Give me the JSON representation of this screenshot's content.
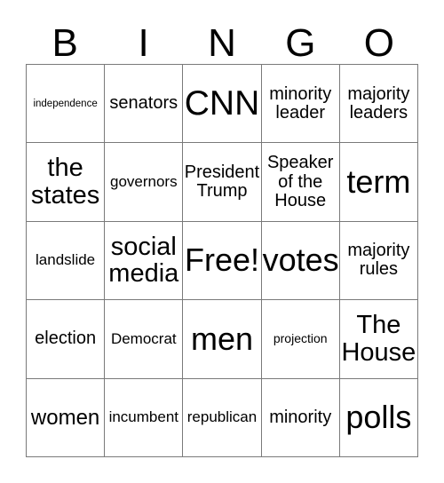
{
  "card": {
    "type": "bingo-card",
    "header_letters": [
      "B",
      "I",
      "N",
      "G",
      "O"
    ],
    "columns": 5,
    "rows": 5,
    "free_space_label": "Free!",
    "border_color": "#7a7a7a",
    "text_color": "#000000",
    "background_color": "#ffffff",
    "cells": [
      {
        "text": "independence",
        "size": "fs-xxs",
        "row": 1,
        "col": 1
      },
      {
        "text": "senators",
        "size": "fs-m",
        "row": 1,
        "col": 2
      },
      {
        "text": "CNN",
        "size": "fs-huge",
        "row": 1,
        "col": 3
      },
      {
        "text": "minority\nleader",
        "size": "fs-m",
        "row": 1,
        "col": 4
      },
      {
        "text": "majority\nleaders",
        "size": "fs-m",
        "row": 1,
        "col": 5
      },
      {
        "text": "the\nstates",
        "size": "fs-xl",
        "row": 2,
        "col": 1
      },
      {
        "text": "governors",
        "size": "fs-s",
        "row": 2,
        "col": 2
      },
      {
        "text": "President\nTrump",
        "size": "fs-m",
        "row": 2,
        "col": 3
      },
      {
        "text": "Speaker\nof the\nHouse",
        "size": "fs-m",
        "row": 2,
        "col": 4
      },
      {
        "text": "term",
        "size": "fs-xxl",
        "row": 2,
        "col": 5
      },
      {
        "text": "landslide",
        "size": "fs-s",
        "row": 3,
        "col": 1
      },
      {
        "text": "social\nmedia",
        "size": "fs-xl",
        "row": 3,
        "col": 2
      },
      {
        "text": "Free!",
        "size": "fs-xxl",
        "row": 3,
        "col": 3
      },
      {
        "text": "votes",
        "size": "fs-xxl",
        "row": 3,
        "col": 4
      },
      {
        "text": "majority\nrules",
        "size": "fs-m",
        "row": 3,
        "col": 5
      },
      {
        "text": "election",
        "size": "fs-m",
        "row": 4,
        "col": 1
      },
      {
        "text": "Democrat",
        "size": "fs-s",
        "row": 4,
        "col": 2
      },
      {
        "text": "men",
        "size": "fs-xxl",
        "row": 4,
        "col": 3
      },
      {
        "text": "projection",
        "size": "fs-xs",
        "row": 4,
        "col": 4
      },
      {
        "text": "The\nHouse",
        "size": "fs-xl",
        "row": 4,
        "col": 5
      },
      {
        "text": "women",
        "size": "fs-l",
        "row": 5,
        "col": 1
      },
      {
        "text": "incumbent",
        "size": "fs-s",
        "row": 5,
        "col": 2
      },
      {
        "text": "republican",
        "size": "fs-s",
        "row": 5,
        "col": 3
      },
      {
        "text": "minority",
        "size": "fs-m",
        "row": 5,
        "col": 4
      },
      {
        "text": "polls",
        "size": "fs-xxl",
        "row": 5,
        "col": 5
      }
    ]
  }
}
